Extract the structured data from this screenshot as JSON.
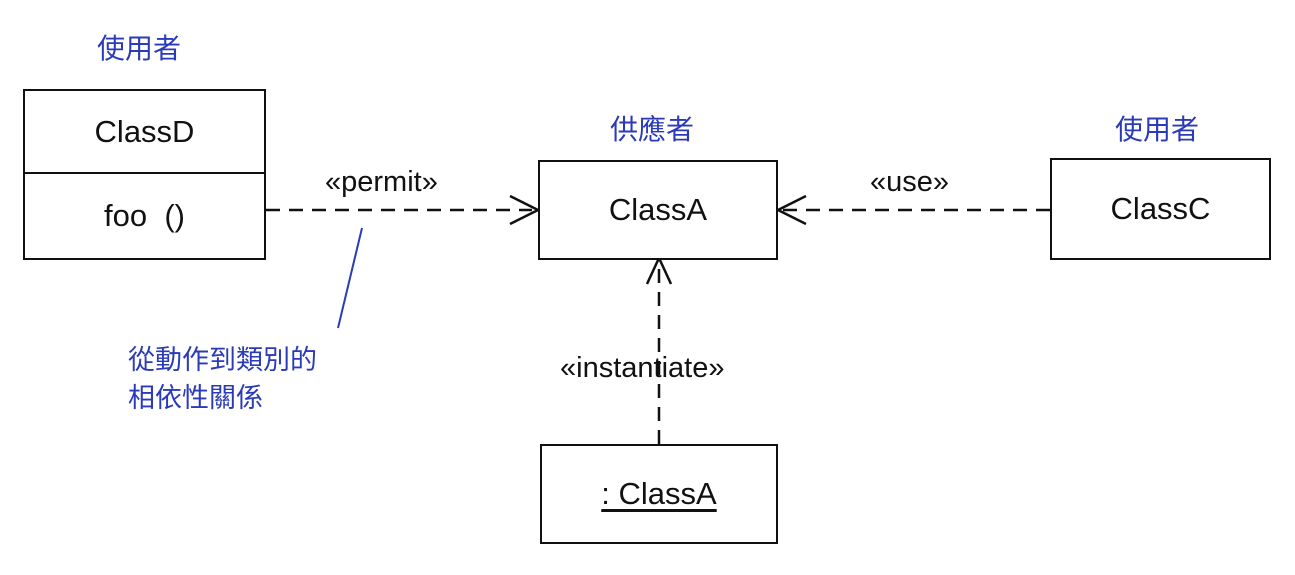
{
  "roles": {
    "user_left": "使用者",
    "supplier": "供應者",
    "user_right": "使用者"
  },
  "classes": {
    "class_d": {
      "name": "ClassD",
      "operation": "foo  ()"
    },
    "class_a": {
      "name": "ClassA"
    },
    "class_c": {
      "name": "ClassC"
    },
    "class_a_instance": {
      "name": ": ClassA"
    }
  },
  "dependencies": {
    "permit": "«permit»",
    "use": "«use»",
    "instantiate": "«instantiate»"
  },
  "note": {
    "line1": "從動作到類別的",
    "line2": "相依性關係"
  },
  "colors": {
    "line": "#111111",
    "annotation": "#2b3bb8"
  }
}
